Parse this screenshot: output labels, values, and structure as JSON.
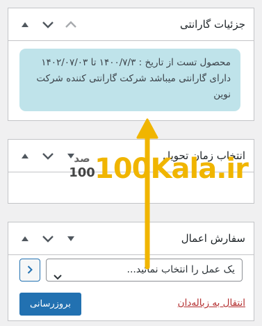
{
  "warranty_box": {
    "title": "جزئیات گارانتی",
    "text": "محصول تست از تاریخ : ۱۴۰۰/۷/۳ تا ۱۴۰۲/۰۷/۰۳ دارای گارانتی میباشد شرکت گارانتی کننده شرکت نوین"
  },
  "delivery_box": {
    "title": "انتخاب زمان تحویل"
  },
  "actions_box": {
    "title": "سفارش اعمال",
    "select_value": "یک عمل را انتخاب نمائید...",
    "apply_icon": "chevron-right-icon",
    "update_label": "بروزرسانی",
    "trash_label": "انتقال به زباله‌دان"
  },
  "watermark": {
    "brand": "100Kala.ir",
    "logo_top": "صد",
    "logo_bottom": "100"
  },
  "colors": {
    "accent": "#2271b1",
    "warranty_bg": "#bfe3ea",
    "arrow": "#f0b500",
    "trash_link": "#b32d2e"
  }
}
